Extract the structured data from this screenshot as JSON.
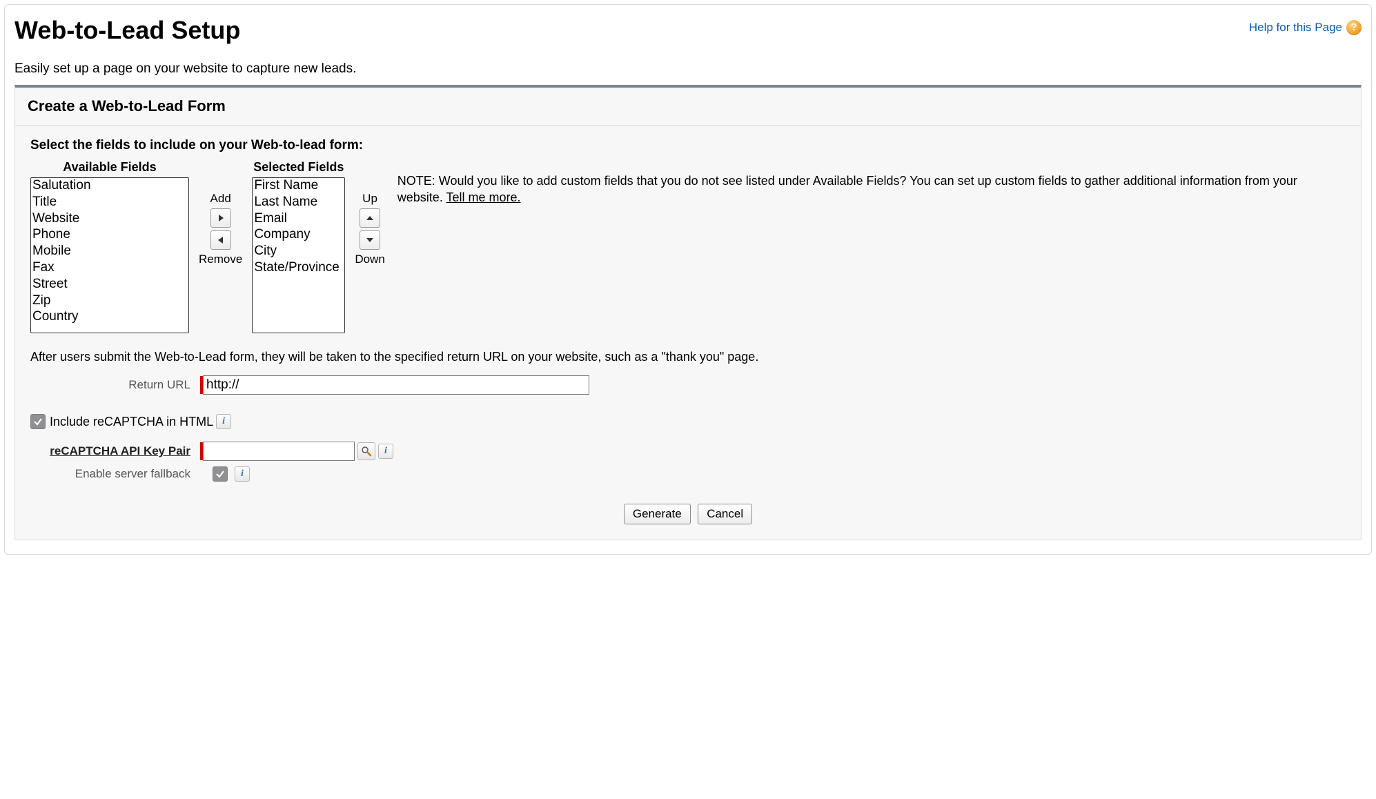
{
  "header": {
    "title": "Web-to-Lead Setup",
    "help_label": "Help for this Page",
    "help_icon_text": "?"
  },
  "subtitle": "Easily set up a page on your website to capture new leads.",
  "panel": {
    "title": "Create a Web-to-Lead Form",
    "instruction": "Select the fields to include on your Web-to-lead form:",
    "available_header": "Available Fields",
    "selected_header": "Selected Fields",
    "available": [
      "Salutation",
      "Title",
      "Website",
      "Phone",
      "Mobile",
      "Fax",
      "Street",
      "Zip",
      "Country"
    ],
    "selected": [
      "First Name",
      "Last Name",
      "Email",
      "Company",
      "City",
      "State/Province"
    ],
    "add_label": "Add",
    "remove_label": "Remove",
    "up_label": "Up",
    "down_label": "Down",
    "note_prefix": "NOTE: Would you like to add custom fields that you do not see listed under Available Fields? You can set up custom fields to gather additional information from your website. ",
    "note_link": "Tell me more."
  },
  "after_text": "After users submit the Web-to-Lead form, they will be taken to the specified return URL on your website, such as a \"thank you\" page.",
  "return_url": {
    "label": "Return URL",
    "value": "http://"
  },
  "recaptcha": {
    "include_label": "Include reCAPTCHA in HTML",
    "include_checked": true,
    "api_label": "reCAPTCHA API Key Pair",
    "api_value": "",
    "fallback_label": "Enable server fallback",
    "fallback_checked": true,
    "info_text": "i"
  },
  "buttons": {
    "generate": "Generate",
    "cancel": "Cancel"
  }
}
